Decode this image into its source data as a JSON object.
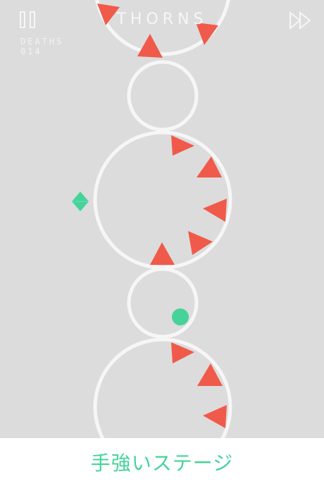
{
  "hud": {
    "level_title": "THORNS",
    "deaths_label": "DEATHS",
    "deaths_count": "014"
  },
  "caption": {
    "text": "手強いステージ"
  },
  "colors": {
    "background": "#dcdcdc",
    "ring": "#f6f6f6",
    "thorn": "#f05a4a",
    "player": "#45d39a",
    "caption_text": "#45d39a"
  },
  "icons": {
    "pause": "pause-icon",
    "fast_forward": "fast-forward-icon",
    "player_ball": "player-ball",
    "checkpoint": "diamond-checkpoint"
  }
}
